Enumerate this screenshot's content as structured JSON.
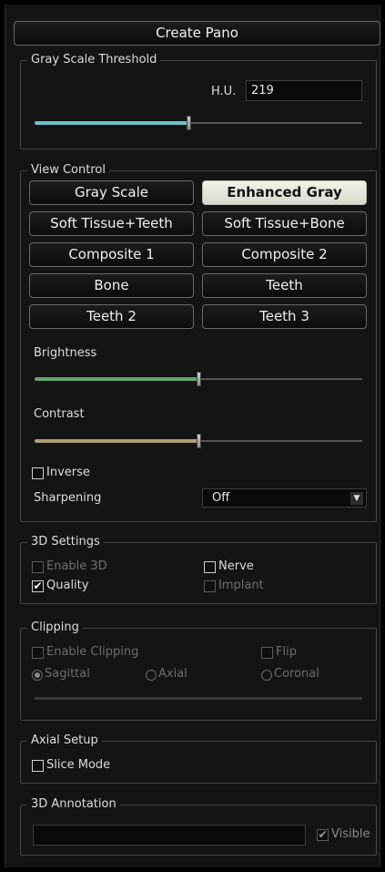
{
  "create_pano": {
    "label": "Create Pano"
  },
  "gray_scale_threshold": {
    "title": "Gray Scale Threshold",
    "hu_label": "H.U.",
    "hu_value": "219",
    "slider_fraction": 0.47,
    "slider_color": "#6fc2c9"
  },
  "view_control": {
    "title": "View Control",
    "buttons": [
      {
        "label": "Gray Scale"
      },
      {
        "label": "Enhanced Gray"
      },
      {
        "label": "Soft Tissue+Teeth"
      },
      {
        "label": "Soft Tissue+Bone"
      },
      {
        "label": "Composite 1"
      },
      {
        "label": "Composite 2"
      },
      {
        "label": "Bone"
      },
      {
        "label": "Teeth"
      },
      {
        "label": "Teeth 2"
      },
      {
        "label": "Teeth 3"
      }
    ],
    "active_button": "Enhanced Gray",
    "brightness_label": "Brightness",
    "brightness_fraction": 0.5,
    "brightness_color": "#5fa66a",
    "contrast_label": "Contrast",
    "contrast_fraction": 0.5,
    "contrast_color": "#b0a06a",
    "inverse_label": "Inverse",
    "inverse_checked": false,
    "sharpening_label": "Sharpening",
    "sharpening_value": "Off"
  },
  "settings_3d": {
    "title": "3D Settings",
    "enable_3d": {
      "label": "Enable 3D",
      "checked": false,
      "enabled": false
    },
    "nerve": {
      "label": "Nerve",
      "checked": false,
      "enabled": true
    },
    "quality": {
      "label": "Quality",
      "checked": true,
      "enabled": true
    },
    "implant": {
      "label": "Implant",
      "checked": false,
      "enabled": false
    }
  },
  "clipping": {
    "title": "Clipping",
    "enable_clipping": {
      "label": "Enable Clipping",
      "checked": false
    },
    "flip": {
      "label": "Flip",
      "checked": false
    },
    "sagittal": {
      "label": "Sagittal",
      "selected": true
    },
    "axial": {
      "label": "Axial",
      "selected": false
    },
    "coronal": {
      "label": "Coronal",
      "selected": false
    }
  },
  "axial_setup": {
    "title": "Axial Setup",
    "slice_mode": {
      "label": "Slice Mode",
      "checked": false
    }
  },
  "annotation_3d": {
    "title": "3D Annotation",
    "text_value": "",
    "visible": {
      "label": "Visible",
      "checked": true
    }
  }
}
